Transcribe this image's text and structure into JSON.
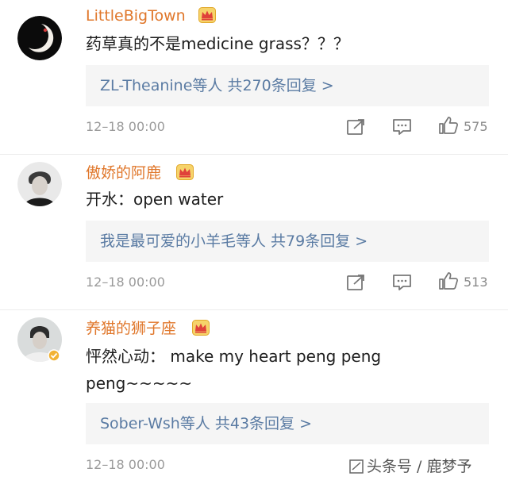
{
  "comments": [
    {
      "username": "LittleBigTown",
      "text_lines": [
        "药草真的不是medicine grass？？？"
      ],
      "reply_summary": "ZL-Theanine等人  共270条回复 >",
      "time": "12–18 00:00",
      "likes": "575",
      "avatar_icon": "dark-crescent-avatar",
      "badge_icon": "crown-icon"
    },
    {
      "username": "傲娇的阿鹿",
      "text_lines": [
        "开水：open water"
      ],
      "reply_summary": "我是最可爱的小羊毛等人  共79条回复 >",
      "time": "12–18 00:00",
      "likes": "513",
      "avatar_icon": "portrait-avatar",
      "badge_icon": "crown-icon"
    },
    {
      "username": "养猫的狮子座",
      "text_lines": [
        "怦然心动： make my heart peng peng",
        "peng~~~~~"
      ],
      "reply_summary": "Sober-Wsh等人  共43条回复 >",
      "time": "12–18 00:00",
      "likes": "",
      "avatar_icon": "portrait-avatar-verified",
      "badge_icon": "crown-icon"
    }
  ],
  "watermark": {
    "text": "头条号 / 鹿梦予"
  },
  "colors": {
    "username": "#e0772b",
    "reply_link": "#5a7ba3",
    "reply_bg": "#f5f5f5",
    "meta": "#9a9a9a",
    "verified_badge": "#f2b233"
  }
}
